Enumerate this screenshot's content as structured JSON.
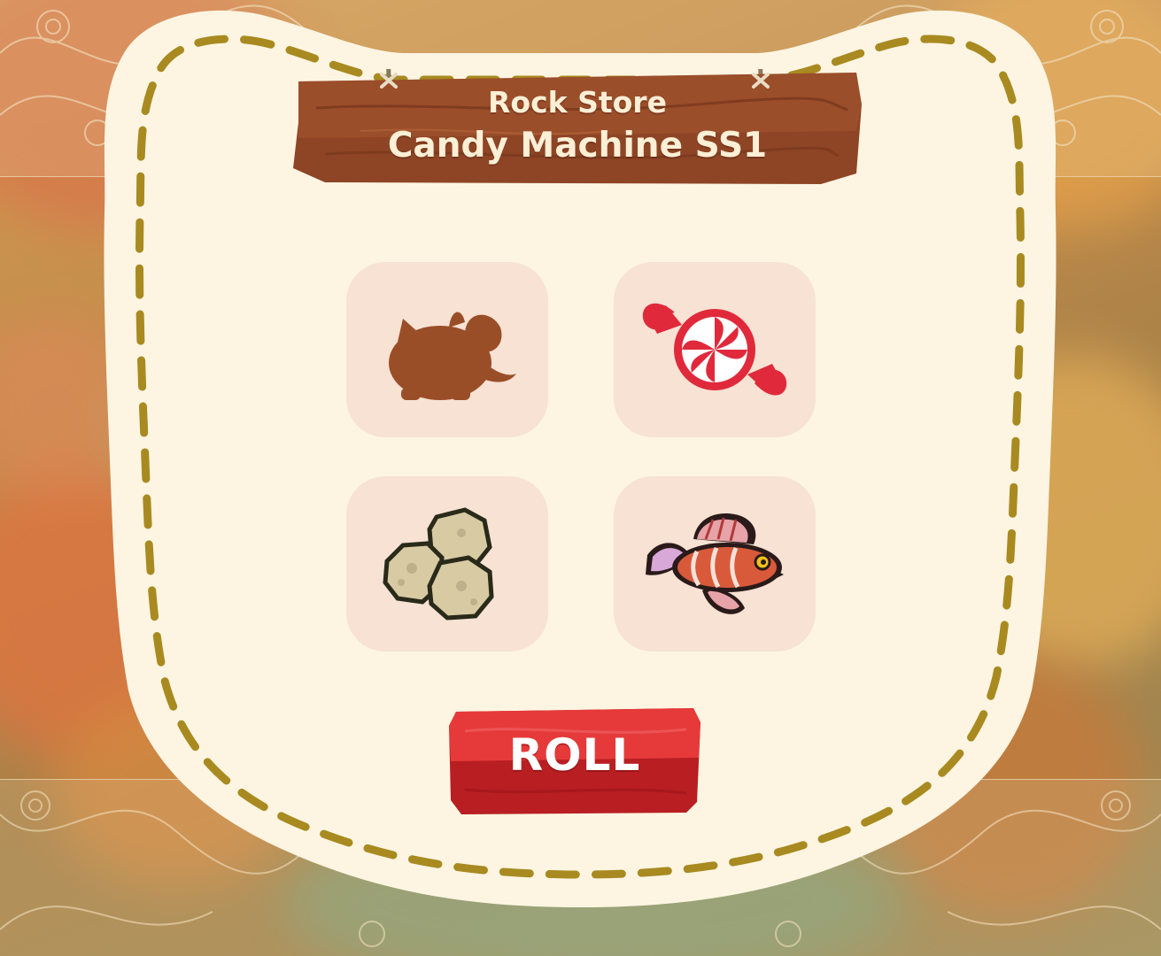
{
  "store": {
    "name": "Rock Store",
    "machine": "Candy Machine SS1"
  },
  "items": [
    {
      "icon": "armadillo-silhouette-icon",
      "state": "locked"
    },
    {
      "icon": "peppermint-candy-icon",
      "state": "revealed"
    },
    {
      "icon": "rocks-icon",
      "state": "revealed"
    },
    {
      "icon": "lionfish-icon",
      "state": "revealed"
    }
  ],
  "actions": {
    "roll_label": "ROLL"
  },
  "colors": {
    "panel": "#fdf5e2",
    "stitch": "#a88a20",
    "slot": "#f7e2d3",
    "sign_wood": "#8e4525",
    "button": "#d6282b",
    "silhouette": "#9a4e28"
  }
}
